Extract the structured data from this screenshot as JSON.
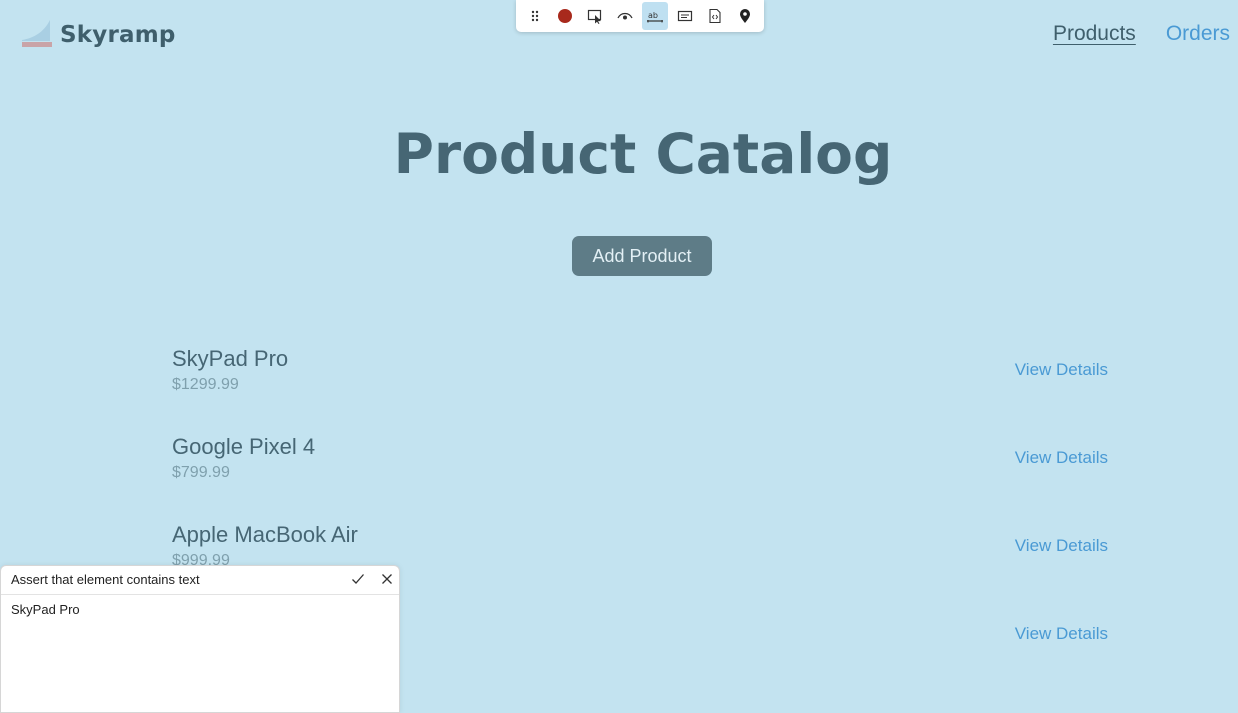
{
  "brand": {
    "name": "Skyramp"
  },
  "nav": {
    "products": "Products",
    "orders": "Orders"
  },
  "toolbar": {
    "icons": [
      "drag-handle-icon",
      "record-icon",
      "select-element-icon",
      "visibility-icon",
      "assert-text-icon",
      "assert-value-icon",
      "code-icon",
      "location-pin-icon"
    ],
    "active": "assert-text-icon",
    "record_color": "#a8291c"
  },
  "page": {
    "title": "Product Catalog",
    "add_button": "Add Product"
  },
  "products": [
    {
      "name": "SkyPad Pro",
      "price": "$1299.99",
      "link": "View Details"
    },
    {
      "name": "Google Pixel 4",
      "price": "$799.99",
      "link": "View Details"
    },
    {
      "name": "Apple MacBook Air",
      "price": "$999.99",
      "link": "View Details"
    },
    {
      "name": "",
      "price": "",
      "link": "View Details"
    }
  ],
  "assert_panel": {
    "title": "Assert that element contains text",
    "value": "SkyPad Pro"
  },
  "colors": {
    "background": "#c3e3f0",
    "link": "#4a9ad4",
    "button": "#5e7c87",
    "heading": "#466674"
  }
}
